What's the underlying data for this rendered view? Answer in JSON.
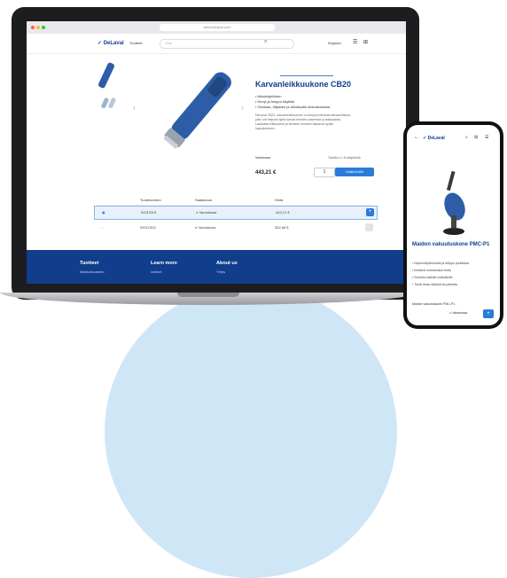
{
  "browser": {
    "url": "www.delaval.com"
  },
  "site": {
    "logo": "✓ DeLaval",
    "nav_products": "Tuotteet",
    "search_placeholder": "Etsi",
    "login": "Kirjaudu",
    "cart_count": ""
  },
  "product": {
    "badge": "Varaosat ja tarvikkeet",
    "title": "Karvanleikkuukone CB20",
    "bullets": [
      "Akkukäyttöinen",
      "Kevyt ja helppo käyttää",
      "Tehokas, hiljainen ja tehokkaita ominaisuuksia"
    ],
    "description": "DeLaval CB20 -karvanleikkuukone on kevyt ja tehokas karvanleikkuri, jolla voit helposti ajella karvat lehmien utareesta ja takaosasta. Laadukas leikkuuterä ja tehokas moottori takaavat hyvän lopputuloksen.",
    "stock_label": "Varastossa",
    "stock_note": "Toimitus 2–5 arkipäivää",
    "price": "443,21 €",
    "price_note": "alv 0%",
    "qty": "1",
    "add_to_cart": "Lisää koriin"
  },
  "table": {
    "headers": [
      "Tuotenumero",
      "Saatavuus",
      "Hinta"
    ],
    "rows": [
      {
        "sku": "92012301",
        "stock": "Varastossa",
        "price": "443,21 €",
        "selected": true
      },
      {
        "sku": "92012302",
        "stock": "Varastossa",
        "price": "352,68 €",
        "selected": false
      }
    ]
  },
  "footer": {
    "cols": [
      {
        "title": "Tuotteet",
        "sub": "Maidontuotanto"
      },
      {
        "title": "Learn more",
        "sub": "Uutiset"
      },
      {
        "title": "About us",
        "sub": "Yritys"
      }
    ]
  },
  "mobile": {
    "logo": "✓ DeLaval",
    "title": "Maidon vakuutuskone PMC-P1",
    "bullets": [
      "Nopea käyttöönotto ja helppo puhdistaa",
      "Kestävä ruostumaton teräs",
      "Soveltuu kaikille maitotiloille",
      "Toimii ilman sähköä tai painetta"
    ],
    "section": "Maidon vakuutuskone PMC-P1",
    "stock": "Varastossa"
  },
  "colors": {
    "brand_blue": "#103d8c",
    "accent": "#2b7bd9",
    "bg_circle": "#cfe6f7"
  }
}
